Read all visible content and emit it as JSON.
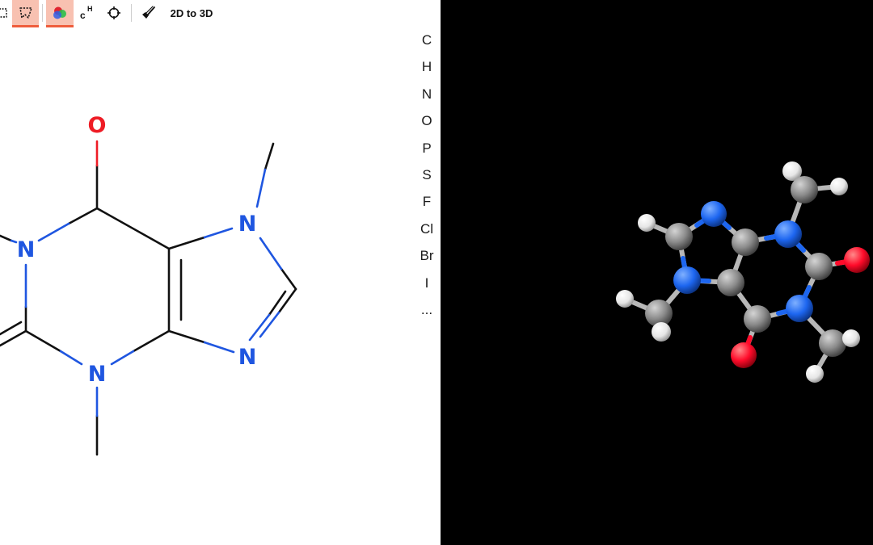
{
  "toolbar": {
    "convert_label": "2D to 3D",
    "accent_color": "#ef5d3c",
    "active_fill": "#f8c1b1",
    "icons": [
      "rect-select-icon",
      "lasso-select-icon",
      "color-atoms-icon",
      "implicit-hydrogens-icon",
      "center-crosshair-icon",
      "eraser-icon"
    ],
    "hydrogen_glyph": {
      "c": "c",
      "h": "H"
    }
  },
  "structure_2d": {
    "atom_labels": {
      "carbonyl_oxygen": "O",
      "n1": "N",
      "n3": "N",
      "n7": "N",
      "n9": "N"
    },
    "colors": {
      "oxygen": "#ee1c25",
      "nitrogen": "#1f56e0",
      "bond": "#111111"
    }
  },
  "element_palette": {
    "items": [
      "C",
      "H",
      "N",
      "O",
      "P",
      "S",
      "F",
      "Cl",
      "Br",
      "I",
      "..."
    ]
  },
  "viewer_3d": {
    "background": "#000000",
    "atom_colors": {
      "carbon": "#8a8a8a",
      "hydrogen": "#ffffff",
      "nitrogen": "#1d66f0",
      "oxygen": "#ff0b2a"
    }
  }
}
